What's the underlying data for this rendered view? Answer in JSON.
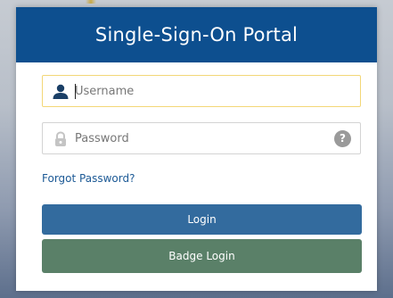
{
  "portal": {
    "title": "Single-Sign-On Portal"
  },
  "username": {
    "icon": "user-icon",
    "placeholder": "Username",
    "value": ""
  },
  "password": {
    "icon": "lock-icon",
    "placeholder": "Password",
    "value": "",
    "help_icon": "question-icon",
    "help_label": "?"
  },
  "links": {
    "forgot_password": "Forgot Password?"
  },
  "buttons": {
    "login": "Login",
    "badge_login": "Badge Login"
  },
  "colors": {
    "header": "#0d4f8f",
    "login_button": "#336b9e",
    "badge_button": "#5a8068",
    "link": "#1d5a96",
    "focus_border": "#f3d777"
  }
}
